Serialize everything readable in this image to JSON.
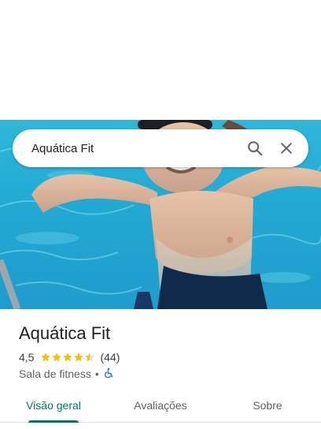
{
  "search": {
    "value": "Aquática Fit"
  },
  "place": {
    "name": "Aquática Fit",
    "rating": "4,5",
    "stars": 4.5,
    "review_count": "(44)",
    "category": "Sala de fitness",
    "separator": "•"
  },
  "tabs": [
    {
      "label": "Visão geral",
      "active": true
    },
    {
      "label": "Avaliações",
      "active": false
    },
    {
      "label": "Sobre",
      "active": false
    }
  ],
  "colors": {
    "accent": "#00796b",
    "star": "#fbbc04",
    "accessibility": "#1a73e8",
    "water": "#22a9d3"
  },
  "icons": {
    "search": "search-icon",
    "close": "close-icon",
    "accessible": "wheelchair-icon"
  }
}
